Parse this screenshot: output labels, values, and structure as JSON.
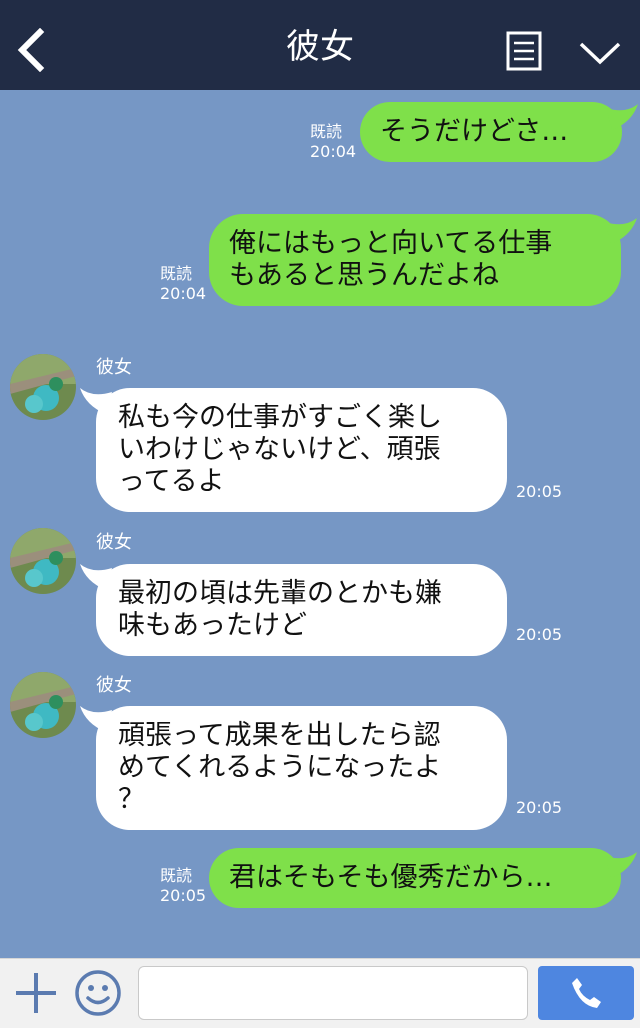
{
  "header": {
    "title": "彼女",
    "back_icon": "chevron-left-icon",
    "memo_icon": "note-icon",
    "menu_icon": "chevron-down-icon"
  },
  "colors": {
    "header_bg": "#212c45",
    "chat_bg": "#7697c5",
    "outgoing_bubble": "#7fe04a",
    "incoming_bubble": "#ffffff",
    "call_button": "#4e86e0"
  },
  "messages": [
    {
      "dir": "out",
      "text": "そうだけどさ…",
      "read": "既読",
      "time": "20:04"
    },
    {
      "dir": "out",
      "text": "俺にはもっと向いてる仕事\nもあると思うんだよね",
      "read": "既読",
      "time": "20:04"
    },
    {
      "dir": "in",
      "sender": "彼女",
      "text": "私も今の仕事がすごく楽し\nいわけじゃないけど、頑張\nってるよ",
      "time": "20:05"
    },
    {
      "dir": "in",
      "sender": "彼女",
      "text": "最初の頃は先輩のとかも嫌\n味もあったけど",
      "time": "20:05"
    },
    {
      "dir": "in",
      "sender": "彼女",
      "text": "頑張って成果を出したら認\nめてくれるようになったよ\n？",
      "time": "20:05"
    },
    {
      "dir": "out",
      "text": "君はそもそも優秀だから…",
      "read": "既読",
      "time": "20:05"
    }
  ],
  "input": {
    "placeholder": "",
    "plus_icon": "plus-icon",
    "emoji_icon": "smiley-icon",
    "call_icon": "phone-icon"
  }
}
